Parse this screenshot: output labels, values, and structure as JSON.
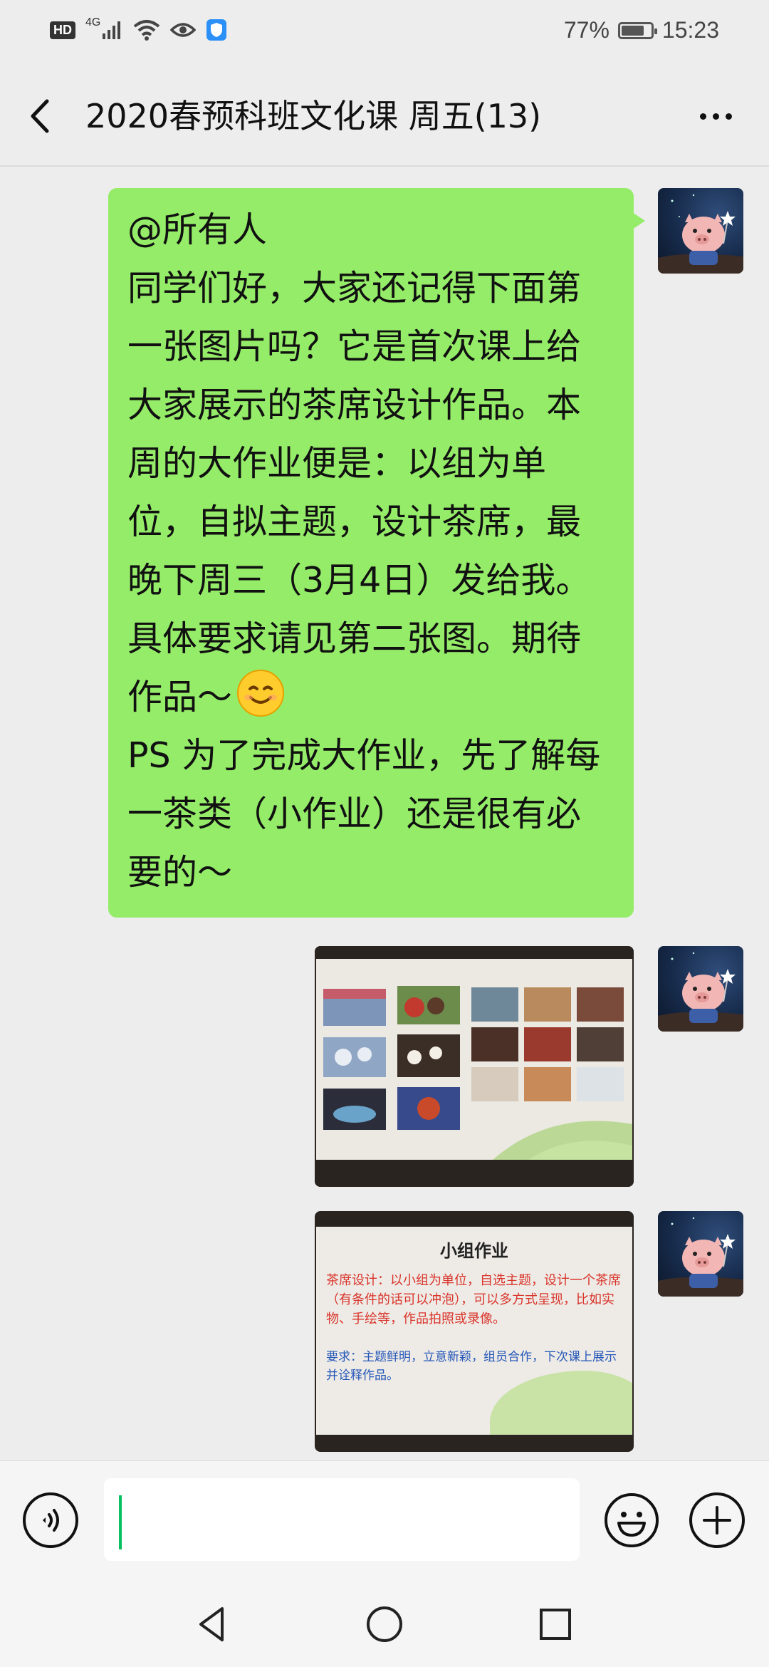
{
  "status_bar": {
    "hd_badge": "HD",
    "network": "4G",
    "battery_text": "77%",
    "battery_level": 0.77,
    "time": "15:23"
  },
  "header": {
    "title": "2020春预科班文化课 周五(13)",
    "back_icon": "chevron-left-icon",
    "more_icon": "more-dots-icon"
  },
  "messages": [
    {
      "type": "text",
      "sender": "self",
      "mention": "@所有人",
      "text_before_emoji": "同学们好，大家还记得下面第一张图片吗？它是首次课上给大家展示的茶席设计作品。本周的大作业便是：以组为单位，自拟主题，设计茶席，最晚下周三（3月4日）发给我。具体要求请见第二张图。期待作品～",
      "emoji": "smile-emoji",
      "text_after_emoji": "PS 为了完成大作业，先了解每一茶类（小作业）还是很有必要的～"
    },
    {
      "type": "image",
      "sender": "self",
      "image": "photo-of-slide-with-tea-set-photos"
    },
    {
      "type": "image",
      "sender": "self",
      "image": "photo-of-slide-group-assignment",
      "slide_title": "小组作业",
      "slide_text_red": "茶席设计：以小组为单位，自选主题，设计一个茶席（有条件的话可以冲泡），可以多方式呈现，比如实物、手绘等，作品拍照或录像。",
      "slide_text_blue": "要求：主题鲜明，立意新颖，组员合作，下次课上展示并诠释作品。"
    }
  ],
  "input_bar": {
    "voice_icon": "voice-icon",
    "input_value": "",
    "emoji_icon": "emoji-icon",
    "add_icon": "plus-icon"
  },
  "nav_bar": {
    "back_icon": "triangle-back-icon",
    "home_icon": "circle-home-icon",
    "recents_icon": "square-recents-icon"
  },
  "colors": {
    "background": "#ededed",
    "bubble": "#95ec69",
    "cursor": "#07c160"
  }
}
